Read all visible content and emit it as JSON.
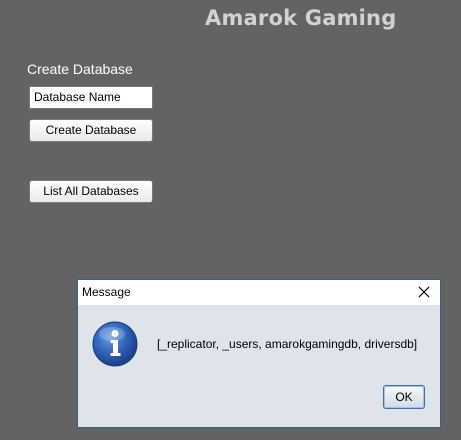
{
  "app": {
    "title": "Amarok Gaming"
  },
  "create_section": {
    "label": "Create Database",
    "input_value": "Database Name",
    "create_button_label": "Create Database"
  },
  "list_button_label": "List All Databases",
  "dialog": {
    "title": "Message",
    "message": "[_replicator, _users, amarokgamingdb, driversdb]",
    "ok_label": "OK",
    "icon": "info-icon"
  }
}
